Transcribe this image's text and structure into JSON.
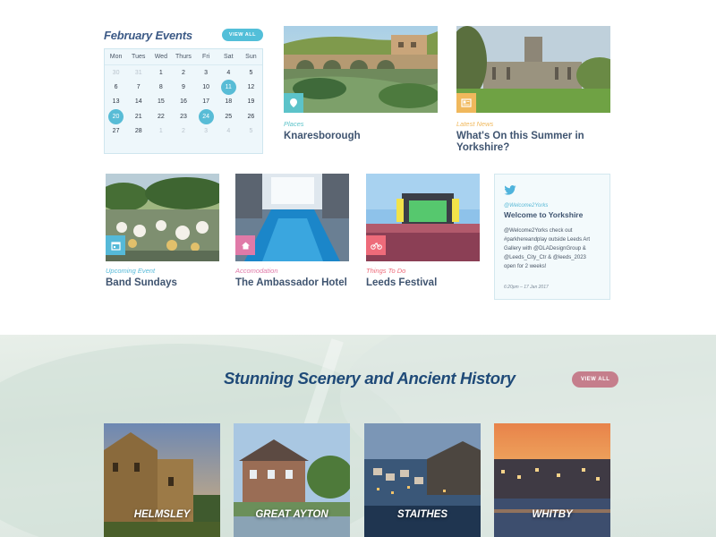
{
  "calendar": {
    "title": "February Events",
    "view_all": "VIEW ALL",
    "weekdays": [
      "Mon",
      "Tues",
      "Wed",
      "Thurs",
      "Fri",
      "Sat",
      "Sun"
    ],
    "weeks": [
      [
        {
          "d": "30",
          "m": true
        },
        {
          "d": "31",
          "m": true
        },
        {
          "d": "1"
        },
        {
          "d": "2"
        },
        {
          "d": "3"
        },
        {
          "d": "4"
        },
        {
          "d": "5"
        }
      ],
      [
        {
          "d": "6"
        },
        {
          "d": "7"
        },
        {
          "d": "8"
        },
        {
          "d": "9"
        },
        {
          "d": "10"
        },
        {
          "d": "11",
          "h": true
        },
        {
          "d": "12"
        }
      ],
      [
        {
          "d": "13"
        },
        {
          "d": "14"
        },
        {
          "d": "15"
        },
        {
          "d": "16"
        },
        {
          "d": "17"
        },
        {
          "d": "18"
        },
        {
          "d": "19"
        }
      ],
      [
        {
          "d": "20",
          "h": true
        },
        {
          "d": "21"
        },
        {
          "d": "22"
        },
        {
          "d": "23"
        },
        {
          "d": "24",
          "h": true
        },
        {
          "d": "25"
        },
        {
          "d": "26"
        }
      ],
      [
        {
          "d": "27"
        },
        {
          "d": "28"
        },
        {
          "d": "1",
          "m": true
        },
        {
          "d": "2",
          "m": true
        },
        {
          "d": "3",
          "m": true
        },
        {
          "d": "4",
          "m": true
        },
        {
          "d": "5",
          "m": true
        }
      ]
    ]
  },
  "cards": {
    "knaresborough": {
      "category": "Places",
      "title": "Knaresborough",
      "color": "#5cc3c9",
      "icon": "map-pin-icon"
    },
    "summer": {
      "category": "Latest News",
      "title_line1": "What's On this Summer in",
      "title_line2": "Yorkshire?",
      "color": "#f0b85c",
      "icon": "newspaper-icon"
    },
    "band": {
      "category": "Upcoming Event",
      "title": "Band Sundays",
      "color": "#55b9d8",
      "icon": "calendar-icon"
    },
    "hotel": {
      "category": "Accomodation",
      "title": "The Ambassador Hotel",
      "color": "#e07aa8",
      "icon": "house-icon"
    },
    "festival": {
      "category": "Things To Do",
      "title": "Leeds Festival",
      "color": "#ee6b7a",
      "icon": "bicycle-icon"
    }
  },
  "tweet": {
    "handle": "@Welcome2Yorks",
    "name": "Welcome to Yorkshire",
    "lines": [
      "@Welcome2Yorks check out",
      "#parkhereandplay outside Leeds Art",
      "Gallery with @DLADesignGroup &",
      "@Leeds_City_Ctr & @leeds_2023",
      "open for 2 weeks!"
    ],
    "time": "6:20pm – 17 Jan 2017",
    "icon": "twitter-icon"
  },
  "scenery": {
    "title": "Stunning Scenery and Ancient History",
    "view_all": "VIEW ALL",
    "places": [
      "HELMSLEY",
      "GREAT AYTON",
      "STAITHES",
      "WHITBY"
    ]
  }
}
